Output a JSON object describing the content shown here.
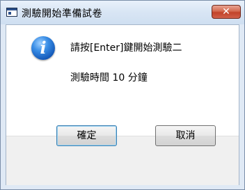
{
  "window": {
    "title": "測驗開始準備試卷",
    "close_label": "✕"
  },
  "message": {
    "icon": "info-icon",
    "line1": "請按[Enter]鍵開始測驗二",
    "line2": "測驗時間 10 分鐘"
  },
  "buttons": {
    "ok_label": "確定",
    "cancel_label": "取消"
  },
  "colors": {
    "title_bar": "#dbe7f5",
    "close_button": "#c7462e",
    "footer": "#f0f0f0",
    "info_icon": "#1b62c2"
  }
}
